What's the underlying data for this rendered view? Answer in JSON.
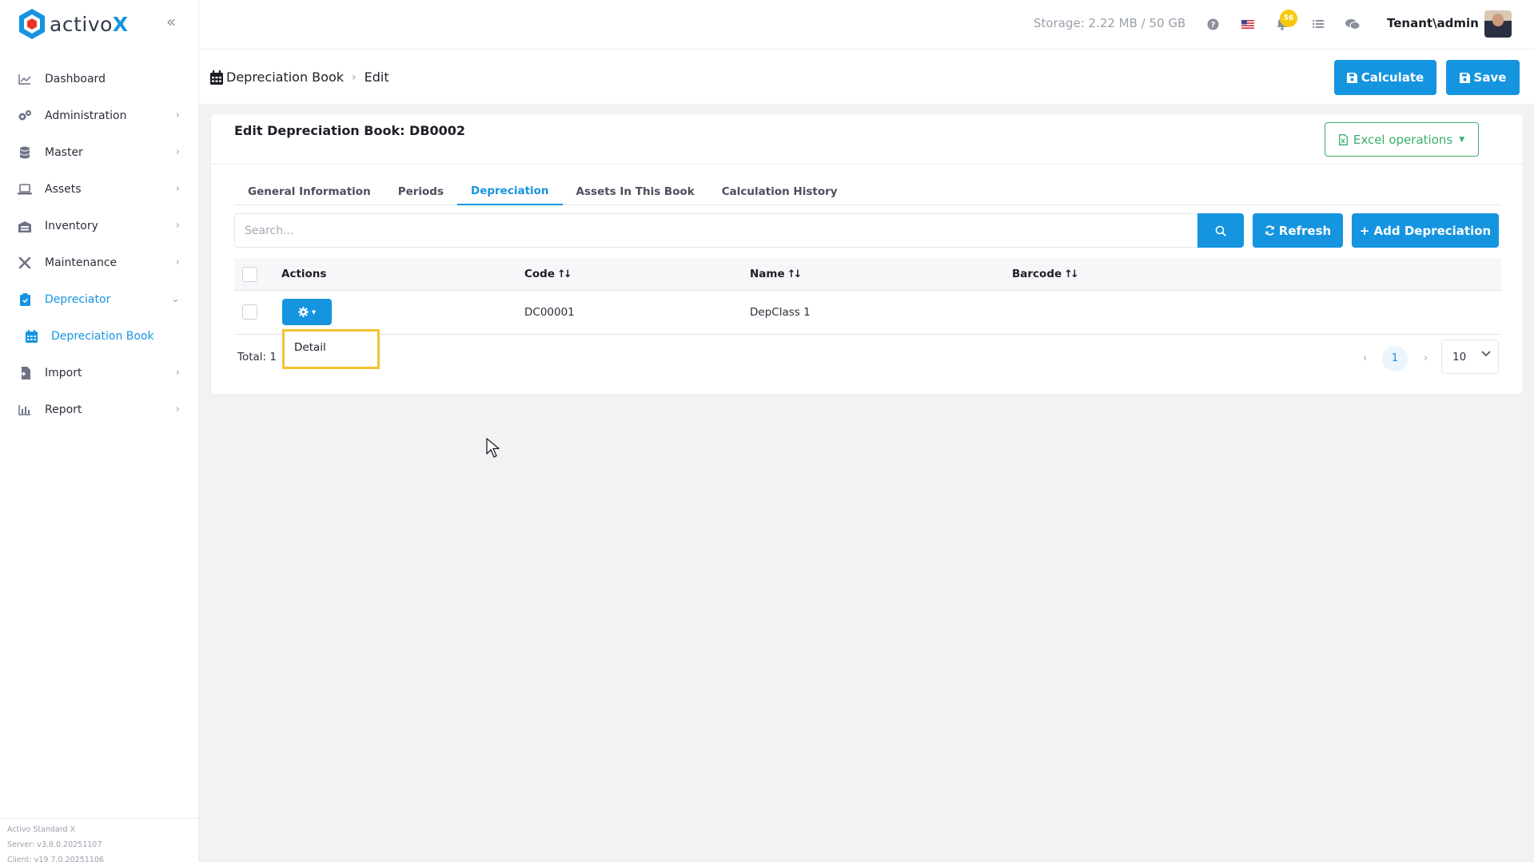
{
  "app": {
    "logo_text_plain": "activo",
    "logo_text_accent": "X",
    "colors": {
      "accent": "#1594e0",
      "excel": "#3aae6b",
      "badge": "#f6c90e",
      "highlight": "#f2c231"
    }
  },
  "sidebar": {
    "items": [
      {
        "label": "Dashboard",
        "icon": "chart-line-icon",
        "has_children": false
      },
      {
        "label": "Administration",
        "icon": "cogs-icon",
        "has_children": true
      },
      {
        "label": "Master",
        "icon": "database-icon",
        "has_children": true
      },
      {
        "label": "Assets",
        "icon": "laptop-icon",
        "has_children": true
      },
      {
        "label": "Inventory",
        "icon": "warehouse-icon",
        "has_children": true
      },
      {
        "label": "Maintenance",
        "icon": "tools-icon",
        "has_children": true
      },
      {
        "label": "Depreciator",
        "icon": "clipboard-icon",
        "has_children": true,
        "expanded": true,
        "active": true
      },
      {
        "label": "Import",
        "icon": "file-import-icon",
        "has_children": true
      },
      {
        "label": "Report",
        "icon": "chart-bar-icon",
        "has_children": true
      }
    ],
    "sub_item": {
      "label": "Depreciation Book",
      "icon": "calendar-icon"
    },
    "version": {
      "product": "Activo Standard X",
      "server": "Server: v3.8.0.20251107",
      "client": "Client: v19.7.0.20251106"
    }
  },
  "topbar": {
    "storage": "Storage: 2.22 MB / 50 GB",
    "notification_count": "56",
    "user": "Tenant\\admin"
  },
  "breadcrumb": {
    "parent": "Depreciation Book",
    "current": "Edit"
  },
  "actions": {
    "calculate": "Calculate",
    "save": "Save"
  },
  "card": {
    "title": "Edit Depreciation Book: DB0002",
    "excel": "Excel operations"
  },
  "tabs": [
    {
      "label": "General Information",
      "active": false
    },
    {
      "label": "Periods",
      "active": false
    },
    {
      "label": "Depreciation",
      "active": true
    },
    {
      "label": "Assets In This Book",
      "active": false
    },
    {
      "label": "Calculation History",
      "active": false
    }
  ],
  "search": {
    "placeholder": "Search...",
    "value": ""
  },
  "toolbar": {
    "refresh": "Refresh",
    "add": "+ Add Depreciation"
  },
  "table": {
    "columns": {
      "actions": "Actions",
      "code": "Code",
      "name": "Name",
      "barcode": "Barcode"
    },
    "rows": [
      {
        "code": "DC00001",
        "name": "DepClass 1",
        "barcode": ""
      }
    ]
  },
  "dropdown": {
    "item": "Detail"
  },
  "pagination": {
    "total": "Total: 1",
    "page": "1",
    "page_size": "10"
  }
}
